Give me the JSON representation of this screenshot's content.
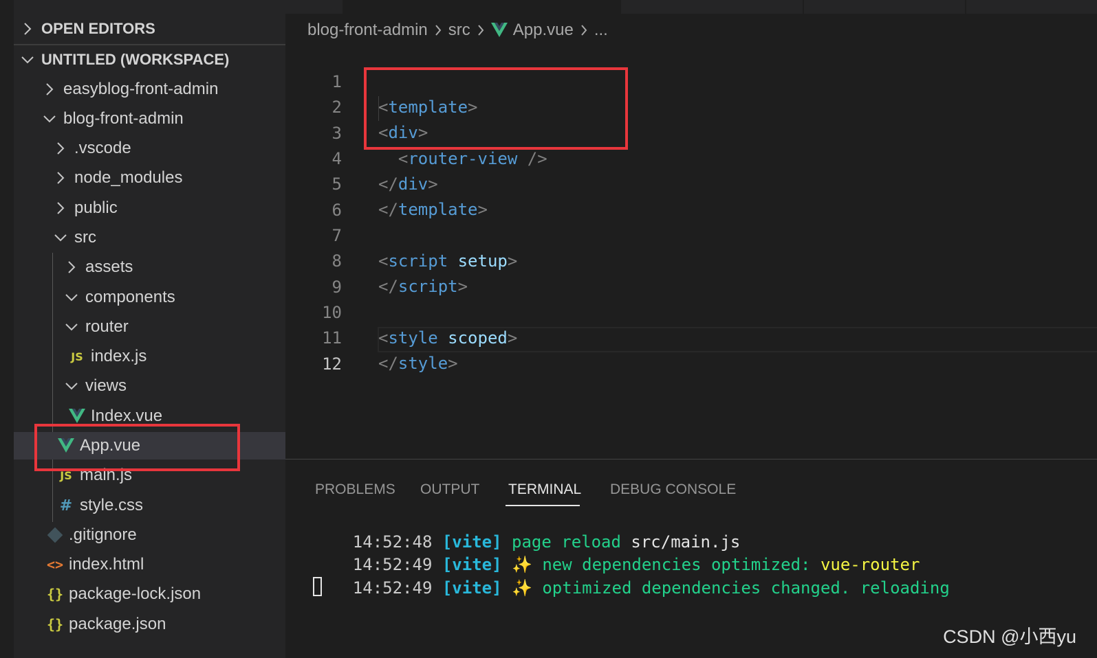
{
  "sidebar": {
    "open_editors": "OPEN EDITORS",
    "workspace": "UNTITLED (WORKSPACE)",
    "items": [
      {
        "label": "easyblog-front-admin",
        "icon": "chevron-right-icon"
      },
      {
        "label": "blog-front-admin",
        "icon": "chevron-down-icon"
      },
      {
        "label": ".vscode",
        "icon": "chevron-right-icon"
      },
      {
        "label": "node_modules",
        "icon": "chevron-right-icon"
      },
      {
        "label": "public",
        "icon": "chevron-right-icon"
      },
      {
        "label": "src",
        "icon": "chevron-down-icon"
      },
      {
        "label": "assets",
        "icon": "chevron-right-icon"
      },
      {
        "label": "components",
        "icon": "chevron-down-icon"
      },
      {
        "label": "router",
        "icon": "chevron-down-icon"
      },
      {
        "label": "index.js",
        "icon": "js-file-icon",
        "badge": "JS"
      },
      {
        "label": "views",
        "icon": "chevron-down-icon"
      },
      {
        "label": "Index.vue",
        "icon": "vue-file-icon"
      },
      {
        "label": "App.vue",
        "icon": "vue-file-icon",
        "selected": true
      },
      {
        "label": "main.js",
        "icon": "js-file-icon",
        "badge": "JS"
      },
      {
        "label": "style.css",
        "icon": "css-file-icon",
        "badge": "#"
      },
      {
        "label": ".gitignore",
        "icon": "git-file-icon"
      },
      {
        "label": "index.html",
        "icon": "html-file-icon",
        "badge": "<>"
      },
      {
        "label": "package-lock.json",
        "icon": "json-file-icon",
        "badge": "{}"
      },
      {
        "label": "package.json",
        "icon": "json-file-icon",
        "badge": "{}"
      }
    ]
  },
  "breadcrumb": [
    "blog-front-admin",
    "src",
    "App.vue",
    "..."
  ],
  "editor": {
    "line_numbers": [
      "1",
      "2",
      "3",
      "4",
      "5",
      "6",
      "7",
      "8",
      "9",
      "10",
      "11",
      "12"
    ],
    "current_line": "12"
  },
  "panel": {
    "tabs": [
      "PROBLEMS",
      "OUTPUT",
      "TERMINAL",
      "DEBUG CONSOLE"
    ],
    "active_tab": "TERMINAL",
    "lines": [
      {
        "time": "14:52:48",
        "tag": "[vite]",
        "text": "page reload",
        "extra": "src/main.js"
      },
      {
        "time": "14:52:49",
        "tag": "[vite]",
        "icon": "sparkles",
        "text": "new dependencies optimized:",
        "extra": "vue-router"
      },
      {
        "time": "14:52:49",
        "tag": "[vite]",
        "icon": "sparkles",
        "text": "optimized dependencies changed. reloading"
      }
    ]
  },
  "watermark": "CSDN @小西yu",
  "colors": {
    "highlight": "#e8363c",
    "vue": "#41b883",
    "tag": "#569cd6",
    "attribute": "#9cdcfe"
  }
}
